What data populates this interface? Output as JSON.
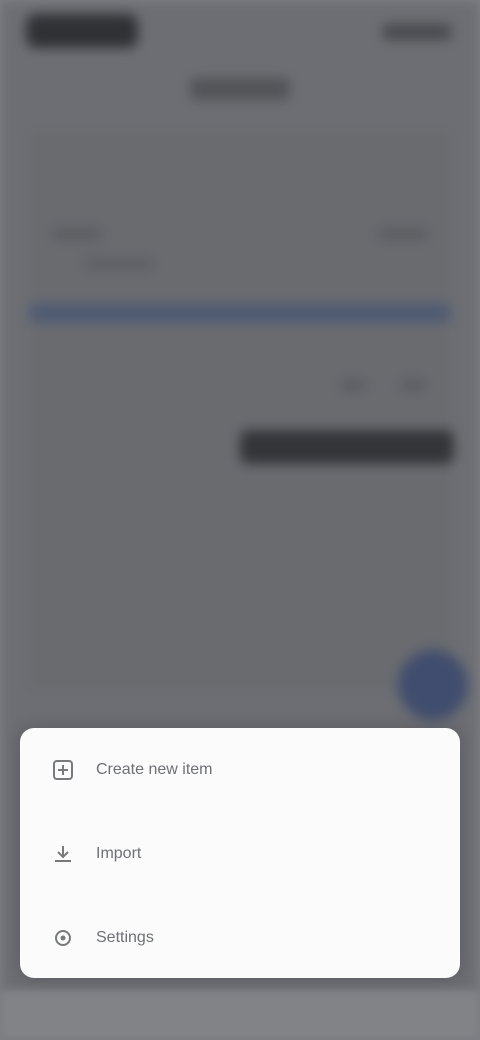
{
  "menu": {
    "items": [
      {
        "label": "Create new item",
        "icon": "add-box-icon"
      },
      {
        "label": "Import",
        "icon": "download-icon"
      },
      {
        "label": "Settings",
        "icon": "gear-icon"
      }
    ]
  },
  "colors": {
    "sheet_bg": "#fbfbfc",
    "scrim": "#727478",
    "accent": "#3e4d72"
  }
}
